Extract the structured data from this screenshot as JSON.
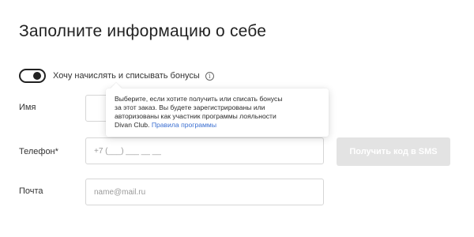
{
  "header": {
    "title": "Заполните информацию о себе"
  },
  "bonus": {
    "toggle_on": true,
    "label": "Хочу начислять и списывать бонусы",
    "info_icon": "info-circle-icon"
  },
  "tooltip": {
    "lines": [
      "Выберите, если хотите получить или списать бонусы",
      "за этот заказ. Вы будете зарегистрированы или",
      "авторизованы как участник программы лояльности"
    ],
    "last_line_text": "Divan Club.",
    "link_text": "Правила программы"
  },
  "form": {
    "name": {
      "label": "Имя",
      "value": ""
    },
    "phone": {
      "label": "Телефон*",
      "value": "+7 (___) ___ __ __"
    },
    "email": {
      "label": "Почта",
      "placeholder": "name@mail.ru"
    },
    "sms_button_label": "Получить код в SMS"
  },
  "colors": {
    "link": "#3b6fd1",
    "button_disabled": "#e3e3e3",
    "input_border": "#d6d6d6"
  }
}
